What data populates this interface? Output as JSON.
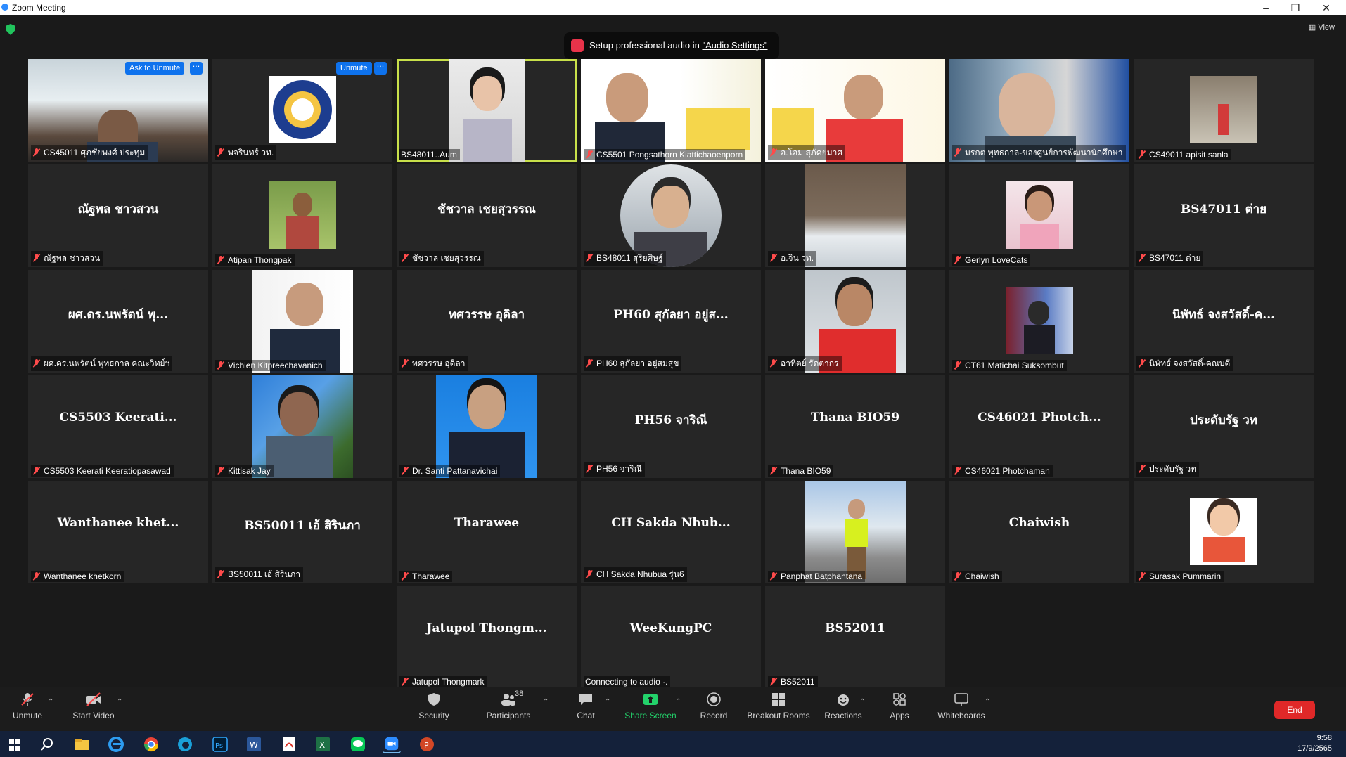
{
  "window": {
    "title": "Zoom Meeting"
  },
  "top": {
    "view_label": "View",
    "banner_text": "Setup professional audio in ",
    "banner_link": "\"Audio Settings\""
  },
  "tiles": {
    "t0": {
      "label": "CS45011 ศุภชัยพงศ์ ประทุม",
      "ask_unmute": "Ask to Unmute"
    },
    "t1": {
      "label": "พจรินทร์ วท.",
      "unmute": "Unmute"
    },
    "t2": {
      "label": "BS48011..Aum"
    },
    "t3": {
      "label": "CS5501 Pongsathorn Kiattichaoenporn"
    },
    "t4": {
      "label": "อ.โอม สุภัคยมาศ"
    },
    "t5": {
      "label": "มรกต พุทธกาล-ของศูนย์การพัฒนานักศึกษา"
    },
    "t6": {
      "label": "CS49011 apisit sanla"
    },
    "t7": {
      "name": "ณัฐพล ชาวสวน",
      "label": "ณัฐพล ชาวสวน"
    },
    "t8": {
      "label": "Atipan Thongpak"
    },
    "t9": {
      "name": "ชัชวาล เชยสุวรรณ",
      "label": "ชัชวาล เชยสุวรรณ"
    },
    "t10": {
      "label": "BS48011 สุริยศิษฐ์"
    },
    "t11": {
      "label": "อ.จิน วท."
    },
    "t12": {
      "label": "Gerlyn LoveCats"
    },
    "t13": {
      "name": "BS47011 ต่าย",
      "label": "BS47011 ต่าย"
    },
    "t14": {
      "name": "ผศ.ดร.นพรัตน์ พุ...",
      "label": "ผศ.ดร.นพรัตน์ พุทธกาล คณะวิทย์ฯ"
    },
    "t15": {
      "label": "Vichien Kitpreechavanich"
    },
    "t16": {
      "name": "ทศวรรษ อุดิลา",
      "label": "ทศวรรษ อุดิลา"
    },
    "t17": {
      "name": "PH60 สุกัลยา อยู่ส...",
      "label": "PH60 สุกัลยา อยู่สมสุข"
    },
    "t18": {
      "label": "อาทิตย์ รัตตากร"
    },
    "t19": {
      "label": "CT61 Matichai Suksombut"
    },
    "t20": {
      "name": "นิพัทธ์ จงสวัสดิ์-ค...",
      "label": "นิพัทธ์ จงสวัสดิ์-คณบดี"
    },
    "t21": {
      "name": "CS5503 Keerati...",
      "label": "CS5503 Keerati Keeratiopasawad"
    },
    "t22": {
      "label": "Kittisak Jay"
    },
    "t23": {
      "label": "Dr. Santi Pattanavichai"
    },
    "t24": {
      "name": "PH56 จาริณี",
      "label": "PH56 จาริณี"
    },
    "t25": {
      "name": "Thana BIO59",
      "label": "Thana BIO59"
    },
    "t26": {
      "name": "CS46021 Photch...",
      "label": "CS46021 Photchaman"
    },
    "t27": {
      "name": "ประดับรัฐ วท",
      "label": "ประดับรัฐ วท"
    },
    "t28": {
      "name": "Wanthanee khet...",
      "label": "Wanthanee khetkorn"
    },
    "t29": {
      "name": "BS50011 เอ้ สิรินภา",
      "label": "BS50011 เอ้ สิรินภา"
    },
    "t30": {
      "name": "Tharawee",
      "label": "Tharawee"
    },
    "t31": {
      "name": "CH Sakda Nhub...",
      "label": "CH Sakda Nhubua รุ่น6"
    },
    "t32": {
      "label": "Panphat Batphantana"
    },
    "t33": {
      "name": "Chaiwish",
      "label": "Chaiwish"
    },
    "t34": {
      "label": "Surasak Pummarin"
    },
    "t35": {
      "name": "Jatupol Thongm...",
      "label": "Jatupol Thongmark"
    },
    "t36": {
      "name": "WeeKungPC",
      "label": "Connecting to audio ·."
    },
    "t37": {
      "name": "BS52011",
      "label": "BS52011"
    }
  },
  "toolbar": {
    "unmute": "Unmute",
    "start_video": "Start Video",
    "security": "Security",
    "participants": "Participants",
    "participants_count": "38",
    "chat": "Chat",
    "share_screen": "Share Screen",
    "record": "Record",
    "breakout_rooms": "Breakout Rooms",
    "reactions": "Reactions",
    "apps": "Apps",
    "whiteboards": "Whiteboards",
    "end": "End"
  },
  "taskbar": {
    "time": "9:58",
    "date": "17/9/2565"
  },
  "colors": {
    "accent": "#0e72ed",
    "active_speaker": "#c8e04a",
    "share_green": "#23d26b",
    "end_red": "#e02828",
    "muted_red": "#ff4b4b"
  }
}
